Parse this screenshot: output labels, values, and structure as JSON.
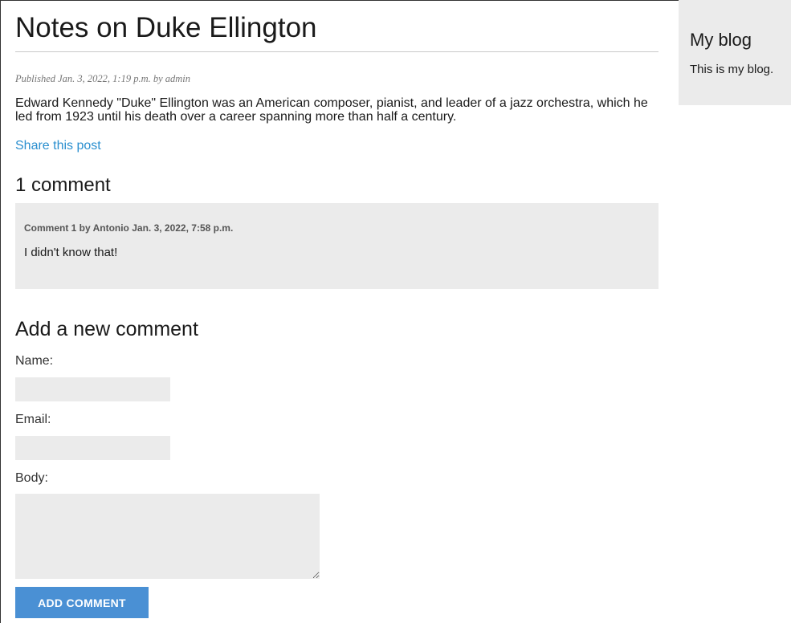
{
  "post": {
    "title": "Notes on Duke Ellington",
    "meta": "Published Jan. 3, 2022, 1:19 p.m. by admin",
    "body": "Edward Kennedy \"Duke\" Ellington was an American composer, pianist, and leader of a jazz orchestra, which he led from 1923 until his death over a career spanning more than half a century.",
    "share_label": "Share this post"
  },
  "comments": {
    "heading": "1 comment",
    "items": [
      {
        "info": "Comment 1 by Antonio Jan. 3, 2022, 7:58 p.m.",
        "text": "I didn't know that!"
      }
    ]
  },
  "form": {
    "heading": "Add a new comment",
    "name_label": "Name:",
    "email_label": "Email:",
    "body_label": "Body:",
    "name_value": "",
    "email_value": "",
    "body_value": "",
    "submit_label": "ADD COMMENT"
  },
  "sidebar": {
    "title": "My blog",
    "text": "This is my blog."
  },
  "colors": {
    "link": "#2a8fcf",
    "button": "#4a90d4",
    "panel": "#ebebeb"
  }
}
